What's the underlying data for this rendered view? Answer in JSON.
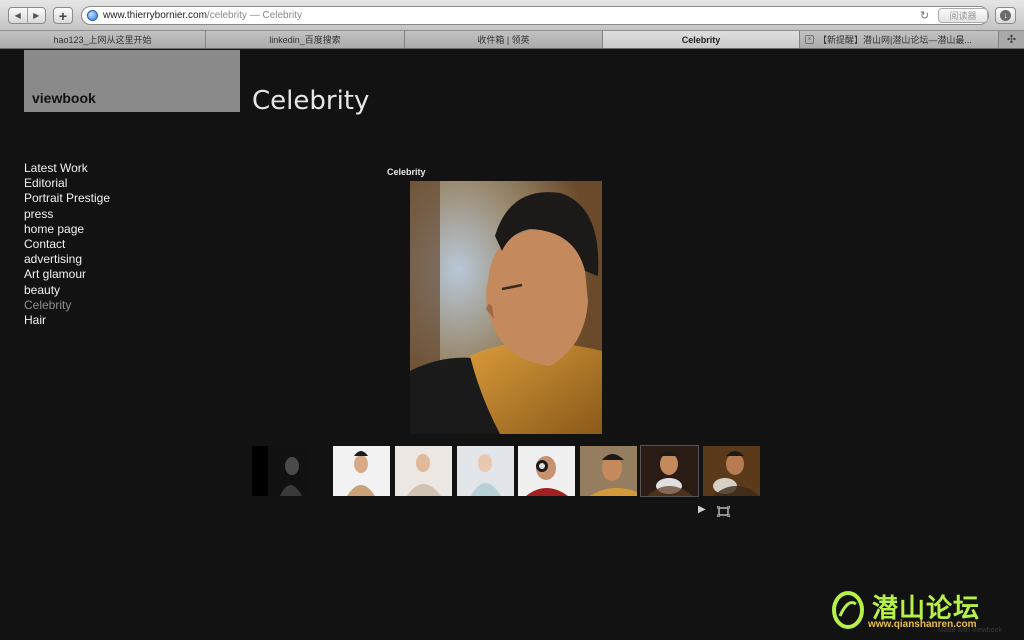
{
  "browser": {
    "url_domain": "www.thierrybornier.com",
    "url_path": "/celebrity — Celebrity",
    "reader_label": "阅读器",
    "tabs": [
      {
        "label": "hao123_上网从这里开始"
      },
      {
        "label": "linkedin_百度搜索"
      },
      {
        "label": "收件箱 | 领英"
      },
      {
        "label": "Celebrity"
      },
      {
        "label": "【新提醒】潜山网|潜山论坛—潜山最..."
      }
    ]
  },
  "site": {
    "logo": "viewbook",
    "title": "Celebrity",
    "nav": [
      {
        "label": "Latest Work",
        "current": false
      },
      {
        "label": "Editorial",
        "current": false
      },
      {
        "label": "Portrait Prestige",
        "current": false
      },
      {
        "label": "press",
        "current": false
      },
      {
        "label": "home page",
        "current": false
      },
      {
        "label": "Contact",
        "current": false
      },
      {
        "label": "advertising",
        "current": false
      },
      {
        "label": "Art glamour",
        "current": false
      },
      {
        "label": "beauty",
        "current": false
      },
      {
        "label": "Celebrity",
        "current": true
      },
      {
        "label": "Hair",
        "current": false
      }
    ],
    "gallery": {
      "label": "Celebrity",
      "thumbnail_count": 8,
      "selected_thumbnail": 6
    },
    "credit": "Made with Viewbook"
  },
  "watermark": {
    "chinese": "潜山论坛",
    "url": "www.qianshanren.com"
  },
  "icons": {
    "back": "back-arrow-icon",
    "forward": "forward-arrow-icon",
    "add": "plus-icon",
    "site": "globe-icon",
    "reload": "reload-icon",
    "downloads": "download-icon",
    "play": "play-icon",
    "fullscreen": "fullscreen-icon"
  }
}
